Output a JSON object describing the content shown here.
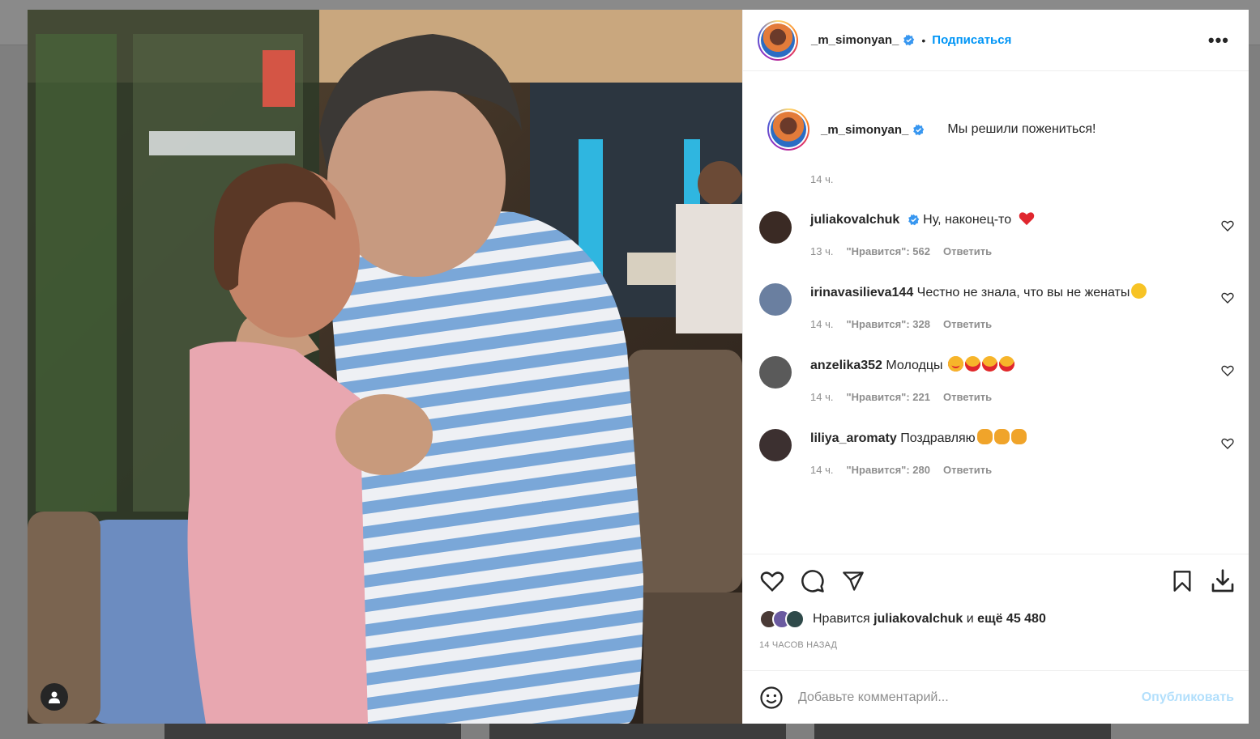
{
  "header": {
    "username": "_m_simonyan_",
    "separator": "•",
    "follow_label": "Подписаться",
    "more_label": "•••"
  },
  "caption": {
    "username": "_m_simonyan_",
    "text": "Мы решили пожениться!",
    "time": "14 ч."
  },
  "comments": [
    {
      "username": "juliakovalchuk",
      "verified": true,
      "text": "Ну, наконец-то",
      "emoji": [
        "red-heart"
      ],
      "time": "13 ч.",
      "likes_label": "\"Нравится\": 562",
      "reply_label": "Ответить",
      "avatar_color": "#3a2a24"
    },
    {
      "username": "irinavasilieva144",
      "verified": false,
      "text": "Честно не знала, что вы не женаты",
      "emoji": [
        "surprised-face"
      ],
      "time": "14 ч.",
      "likes_label": "\"Нравится\": 328",
      "reply_label": "Ответить",
      "avatar_color": "#6a7fa0"
    },
    {
      "username": "anzelika352",
      "verified": false,
      "text": "Молодцы",
      "emoji": [
        "heart-eyes",
        "heart-eyes",
        "heart-eyes",
        "heart-eyes"
      ],
      "time": "14 ч.",
      "likes_label": "\"Нравится\": 221",
      "reply_label": "Ответить",
      "avatar_color": "#5a5a5a"
    },
    {
      "username": "liliya_aromaty",
      "verified": false,
      "text": "Поздравляю",
      "emoji": [
        "clapping-hands",
        "clapping-hands",
        "clapping-hands"
      ],
      "time": "14 ч.",
      "likes_label": "\"Нравится\": 280",
      "reply_label": "Ответить",
      "avatar_color": "#3c3030"
    }
  ],
  "likes": {
    "prefix": "Нравится",
    "user": "juliakovalchuk",
    "middle": "и",
    "count": "ещё 45 480"
  },
  "time_ago": "14 ЧАСОВ НАЗАД",
  "comment_box": {
    "placeholder": "Добавьте комментарий...",
    "publish_label": "Опубликовать"
  },
  "colors": {
    "accent": "#0095f6",
    "verified": "#3897f0",
    "publish_disabled": "#b2dffc",
    "heart_red": "#ed4956"
  },
  "icons": [
    "tag-user-icon",
    "verified-icon",
    "heart-icon",
    "comment-icon",
    "share-icon",
    "bookmark-icon",
    "download-icon",
    "emoji-icon"
  ]
}
